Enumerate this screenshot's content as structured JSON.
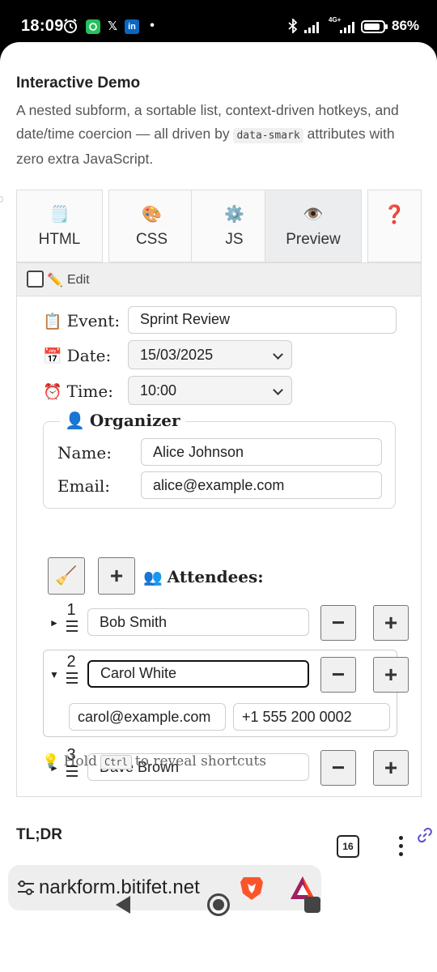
{
  "status_bar": {
    "time": "18:09",
    "icons": [
      "alarm-icon",
      "app-icon",
      "x-icon",
      "linkedin-icon",
      "dot-icon",
      "bluetooth-icon",
      "signal-icon",
      "network-4g-icon",
      "battery-icon"
    ],
    "x_glyph": "𝕏",
    "linkedin_glyph": "in",
    "network": "4G+",
    "battery_percent": "86%",
    "battery_level": 0.86
  },
  "page": {
    "title": "Interactive Demo",
    "intro_before": "A nested subform, a sortable list, context-driven hotkeys, and date/time coercion — all driven by ",
    "intro_code": "data-smark",
    "intro_after": " attributes with zero extra JavaScript."
  },
  "tabs": [
    {
      "icon": "🗒️",
      "label": "HTML",
      "active": false
    },
    {
      "icon": "🎨",
      "label": "CSS",
      "active": false
    },
    {
      "icon": "⚙️",
      "label": "JS",
      "active": false
    },
    {
      "icon": "👁️",
      "label": "Preview",
      "active": true
    },
    {
      "icon": "❓",
      "label": "",
      "active": false
    }
  ],
  "edit_toggle": {
    "checked": false,
    "icon": "✏️",
    "label": "Edit"
  },
  "form": {
    "event": {
      "icon": "📋",
      "label": "Event:",
      "value": "Sprint Review"
    },
    "date": {
      "icon": "📅",
      "label": "Date:",
      "value": "15/03/2025"
    },
    "time": {
      "icon": "⏰",
      "label": "Time:",
      "value": "10:00"
    },
    "organizer": {
      "legend_icon": "👤",
      "legend": "Organizer",
      "name_label": "Name:",
      "name_value": "Alice Johnson",
      "email_label": "Email:",
      "email_value": "alice@example.com"
    },
    "attendees": {
      "clear_icon": "🧹",
      "add_label": "+",
      "title_icon": "👥",
      "title": "Attendees:",
      "items": [
        {
          "index": "1",
          "name": "Bob Smith",
          "expanded": false,
          "email": "",
          "phone": ""
        },
        {
          "index": "2",
          "name": "Carol White",
          "expanded": true,
          "email": "carol@example.com",
          "phone": "+1 555 200 0002"
        },
        {
          "index": "3",
          "name": "Dave Brown",
          "expanded": false,
          "email": "",
          "phone": ""
        }
      ],
      "remove_label": "−",
      "insert_label": "+",
      "collapsed_marker": "►",
      "expanded_marker": "▼"
    },
    "hint": {
      "icon": "💡",
      "before": "Hold",
      "key": "Ctrl",
      "after": "to reveal shortcuts"
    }
  },
  "tldr": {
    "label": "TL;DR"
  },
  "browser": {
    "url": "narkform.bitifet.net",
    "tab_count": "16"
  }
}
